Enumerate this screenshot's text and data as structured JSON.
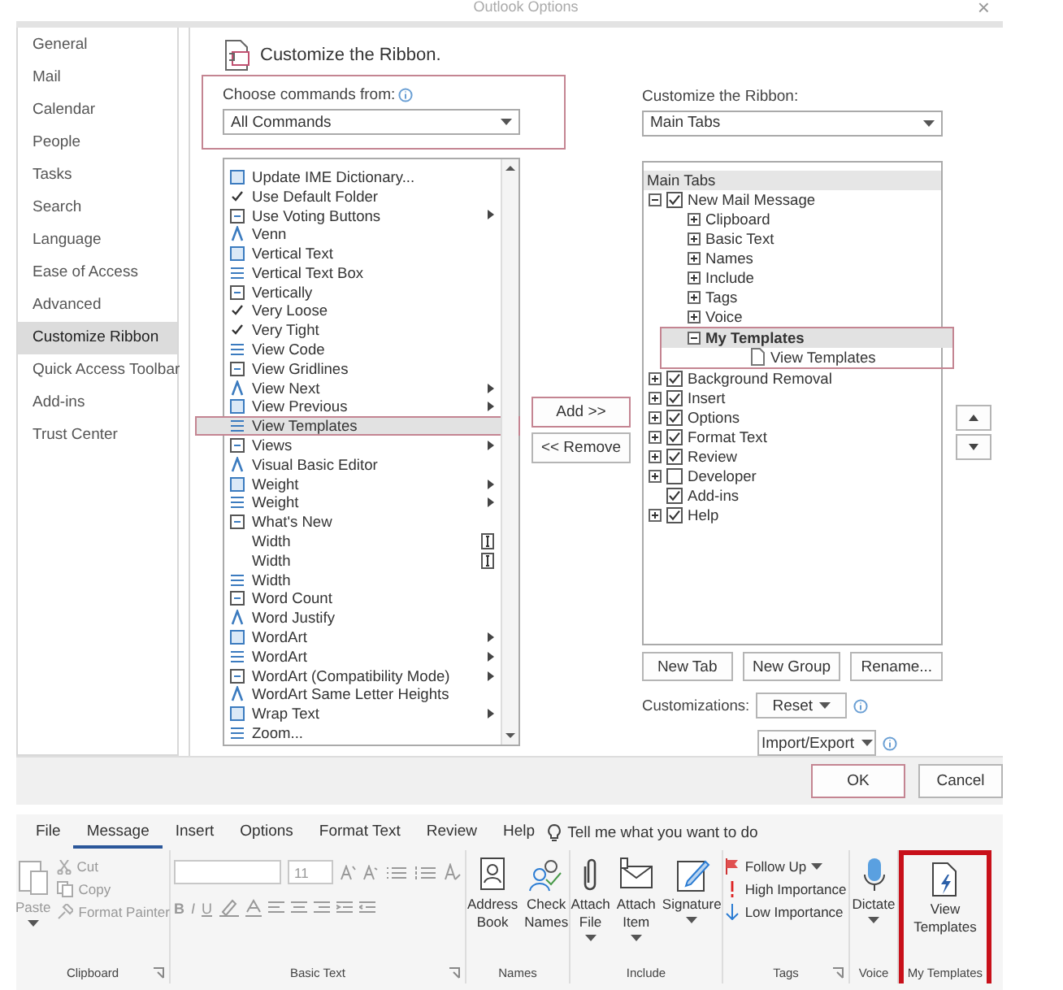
{
  "window": {
    "title": "Outlook Options",
    "close": "×"
  },
  "nav": {
    "items": [
      {
        "label": "General",
        "selected": false
      },
      {
        "label": "Mail",
        "selected": false
      },
      {
        "label": "Calendar",
        "selected": false
      },
      {
        "label": "People",
        "selected": false
      },
      {
        "label": "Tasks",
        "selected": false
      },
      {
        "label": "Search",
        "selected": false
      },
      {
        "label": "Language",
        "selected": false
      },
      {
        "label": "Ease of Access",
        "selected": false
      },
      {
        "label": "Advanced",
        "selected": false
      },
      {
        "label": "Customize Ribbon",
        "selected": true
      },
      {
        "label": "Quick Access Toolbar",
        "selected": false
      },
      {
        "label": "Add-ins",
        "selected": false
      },
      {
        "label": "Trust Center",
        "selected": false
      }
    ]
  },
  "header": {
    "title": "Customize the Ribbon."
  },
  "commands": {
    "label": "Choose commands from:",
    "value": "All Commands",
    "highlighted": true,
    "items": [
      {
        "label": "Update IME Dictionary...",
        "kind": "icon",
        "selected": false
      },
      {
        "label": "Use Default Folder",
        "kind": "tick",
        "selected": false
      },
      {
        "label": "Use Voting Buttons",
        "kind": "icon",
        "submenu": true,
        "selected": false
      },
      {
        "label": "Venn",
        "kind": "icon",
        "selected": false
      },
      {
        "label": "Vertical Text",
        "kind": "icon",
        "selected": false
      },
      {
        "label": "Vertical Text Box",
        "kind": "icon",
        "selected": false
      },
      {
        "label": "Vertically",
        "kind": "icon",
        "selected": false
      },
      {
        "label": "Very Loose",
        "kind": "tick",
        "selected": false
      },
      {
        "label": "Very Tight",
        "kind": "tick",
        "selected": false
      },
      {
        "label": "View Code",
        "kind": "icon",
        "selected": false
      },
      {
        "label": "View Gridlines",
        "kind": "icon",
        "selected": false
      },
      {
        "label": "View Next",
        "kind": "icon",
        "submenu": true,
        "selected": false
      },
      {
        "label": "View Previous",
        "kind": "icon",
        "submenu": true,
        "selected": false
      },
      {
        "label": "View Templates",
        "kind": "icon",
        "selected": true
      },
      {
        "label": "Views",
        "kind": "icon",
        "submenu": true,
        "selected": false
      },
      {
        "label": "Visual Basic Editor",
        "kind": "icon",
        "selected": false
      },
      {
        "label": "Weight",
        "kind": "icon",
        "submenu": true,
        "selected": false
      },
      {
        "label": "Weight",
        "kind": "icon",
        "submenu": true,
        "selected": false
      },
      {
        "label": "What's New",
        "kind": "icon",
        "selected": false
      },
      {
        "label": "Width",
        "kind": "plain",
        "edit_box": true,
        "selected": false
      },
      {
        "label": "Width",
        "kind": "plain",
        "edit_box": true,
        "selected": false
      },
      {
        "label": "Width",
        "kind": "icon",
        "selected": false
      },
      {
        "label": "Word Count",
        "kind": "icon",
        "selected": false
      },
      {
        "label": "Word Justify",
        "kind": "icon",
        "selected": false
      },
      {
        "label": "WordArt",
        "kind": "icon",
        "submenu": true,
        "selected": false
      },
      {
        "label": "WordArt",
        "kind": "icon",
        "submenu": true,
        "selected": false
      },
      {
        "label": "WordArt (Compatibility Mode)",
        "kind": "icon",
        "submenu": true,
        "selected": false
      },
      {
        "label": "WordArt Same Letter Heights",
        "kind": "icon",
        "selected": false
      },
      {
        "label": "Wrap Text",
        "kind": "icon",
        "submenu": true,
        "selected": false
      },
      {
        "label": "Zoom...",
        "kind": "icon",
        "selected": false
      }
    ]
  },
  "transfer": [
    {
      "label": "Add >>",
      "highlighted": true
    },
    {
      "label": "<< Remove",
      "highlighted": false
    }
  ],
  "ribbon_config": {
    "label": "Customize the Ribbon:",
    "value": "Main Tabs",
    "tree_header": "Main Tabs",
    "tree": [
      {
        "label": "New Mail Message",
        "kind": "tab",
        "checked": true,
        "expanded": true,
        "selected": false,
        "children": [
          {
            "label": "Clipboard",
            "kind": "group",
            "expanded": false,
            "selected": false
          },
          {
            "label": "Basic Text",
            "kind": "group",
            "expanded": false,
            "selected": false
          },
          {
            "label": "Names",
            "kind": "group",
            "expanded": false,
            "selected": false
          },
          {
            "label": "Include",
            "kind": "group",
            "expanded": false,
            "selected": false
          },
          {
            "label": "Tags",
            "kind": "group",
            "expanded": false,
            "selected": false
          },
          {
            "label": "Voice",
            "kind": "group",
            "expanded": false,
            "selected": false
          },
          {
            "label": "My Templates",
            "kind": "group",
            "expanded": true,
            "selected": true,
            "children": [
              {
                "label": "View Templates",
                "kind": "command",
                "selected": false
              }
            ]
          }
        ]
      },
      {
        "label": "Background Removal",
        "kind": "tab",
        "checked": true,
        "expanded": false,
        "selected": false
      },
      {
        "label": "Insert",
        "kind": "tab",
        "checked": true,
        "expanded": false,
        "selected": false
      },
      {
        "label": "Options",
        "kind": "tab",
        "checked": true,
        "expanded": false,
        "selected": false
      },
      {
        "label": "Format Text",
        "kind": "tab",
        "checked": true,
        "expanded": false,
        "selected": false
      },
      {
        "label": "Review",
        "kind": "tab",
        "checked": true,
        "expanded": false,
        "selected": false
      },
      {
        "label": "Developer",
        "kind": "tab",
        "checked": false,
        "expanded": false,
        "selected": false
      },
      {
        "label": "Add-ins",
        "kind": "tab",
        "checked": true,
        "selected": false
      },
      {
        "label": "Help",
        "kind": "tab",
        "checked": true,
        "expanded": false,
        "selected": false
      }
    ],
    "buttons": [
      "New Tab",
      "New Group",
      "Rename..."
    ],
    "customizations_label": "Customizations:",
    "reset": "Reset",
    "import_export": "Import/Export"
  },
  "footer": {
    "buttons": [
      {
        "label": "OK",
        "highlighted": true
      },
      {
        "label": "Cancel",
        "highlighted": false
      }
    ]
  },
  "ribbon": {
    "tabs": [
      {
        "label": "File",
        "selected": false
      },
      {
        "label": "Message",
        "selected": true
      },
      {
        "label": "Insert",
        "selected": false
      },
      {
        "label": "Options",
        "selected": false
      },
      {
        "label": "Format Text",
        "selected": false
      },
      {
        "label": "Review",
        "selected": false
      },
      {
        "label": "Help",
        "selected": false
      }
    ],
    "tell_me": "Tell me what you want to do",
    "groups": [
      {
        "label": "Clipboard",
        "kind": "clipboard",
        "disabled": true,
        "launcher": true,
        "highlighted": false,
        "paste": "Paste",
        "items": [
          "Cut",
          "Copy",
          "Format Painter"
        ]
      },
      {
        "label": "Basic Text",
        "kind": "font",
        "disabled": true,
        "launcher": true,
        "highlighted": false,
        "size": "11",
        "format": [
          "B",
          "I",
          "U"
        ]
      },
      {
        "label": "Names",
        "kind": "large",
        "disabled": false,
        "highlighted": false,
        "buttons": [
          {
            "label": "Address Book",
            "dropdown": false
          },
          {
            "label": "Check Names",
            "dropdown": false
          }
        ]
      },
      {
        "label": "Include",
        "kind": "large",
        "disabled": false,
        "highlighted": false,
        "buttons": [
          {
            "label": "Attach File",
            "dropdown": true
          },
          {
            "label": "Attach Item",
            "dropdown": true
          },
          {
            "label": "Signature",
            "dropdown": true
          }
        ]
      },
      {
        "label": "Tags",
        "kind": "small",
        "disabled": false,
        "launcher": true,
        "highlighted": false,
        "items": [
          {
            "label": "Follow Up",
            "dropdown": true
          },
          {
            "label": "High Importance",
            "dropdown": false
          },
          {
            "label": "Low Importance",
            "dropdown": false
          }
        ]
      },
      {
        "label": "Voice",
        "kind": "large",
        "disabled": false,
        "highlighted": false,
        "buttons": [
          {
            "label": "Dictate",
            "dropdown": true
          }
        ]
      },
      {
        "label": "My Templates",
        "kind": "large",
        "disabled": false,
        "highlighted": true,
        "buttons": [
          {
            "label": "View Templates",
            "dropdown": false
          }
        ]
      }
    ]
  }
}
